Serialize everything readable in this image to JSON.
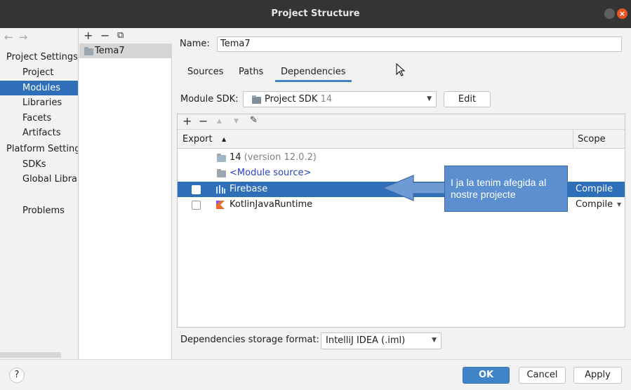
{
  "window": {
    "title": "Project Structure",
    "close_glyph": "×"
  },
  "sidebar": {
    "nav_back": "←",
    "nav_forward": "→",
    "section_project": "Project Settings",
    "project_items": [
      "Project",
      "Modules",
      "Libraries",
      "Facets",
      "Artifacts"
    ],
    "selected": "Modules",
    "section_platform": "Platform Settings",
    "platform_items": [
      "SDKs",
      "Global Libraries"
    ],
    "problems": "Problems"
  },
  "modules": {
    "toolbar": {
      "add": "+",
      "remove": "−",
      "copy": "⧉"
    },
    "items": [
      "Tema7"
    ]
  },
  "main": {
    "name_label": "Name:",
    "name_value": "Tema7",
    "tabs": [
      "Sources",
      "Paths",
      "Dependencies"
    ],
    "active_tab": "Dependencies",
    "module_sdk_label": "Module SDK:",
    "module_sdk_value": "Project SDK",
    "module_sdk_version": "14",
    "edit_button": "Edit",
    "deps_toolbar": {
      "add": "+",
      "remove": "−",
      "up": "▲",
      "down": "▼",
      "edit": "✎"
    },
    "columns": {
      "export": "Export",
      "sort_glyph": "▲",
      "scope": "Scope"
    },
    "rows": [
      {
        "name": "14",
        "extra": " (version 12.0.2)",
        "checkbox": false,
        "scope": "",
        "icon": "sdk-folder-icon"
      },
      {
        "name": "<Module source>",
        "extra": "",
        "checkbox": false,
        "scope": "",
        "icon": "module-source-icon"
      },
      {
        "name": "Firebase",
        "extra": "",
        "checkbox": true,
        "scope": "Compile",
        "icon": "library-icon",
        "selected": true
      },
      {
        "name": "KotlinJavaRuntime",
        "extra": "",
        "checkbox": true,
        "scope": "Compile",
        "icon": "kotlin-icon"
      }
    ],
    "storage_label": "Dependencies storage format:",
    "storage_value": "IntelliJ IDEA (.iml)"
  },
  "callout": {
    "text": "I ja la tenim afegida al nostre projecte",
    "color": "#5b8fd0"
  },
  "footer": {
    "help": "?",
    "ok": "OK",
    "cancel": "Cancel",
    "apply": "Apply"
  },
  "colors": {
    "accent": "#2f6fb9",
    "primary_button": "#4083c9",
    "titlebar": "#343434",
    "close": "#e95420"
  }
}
